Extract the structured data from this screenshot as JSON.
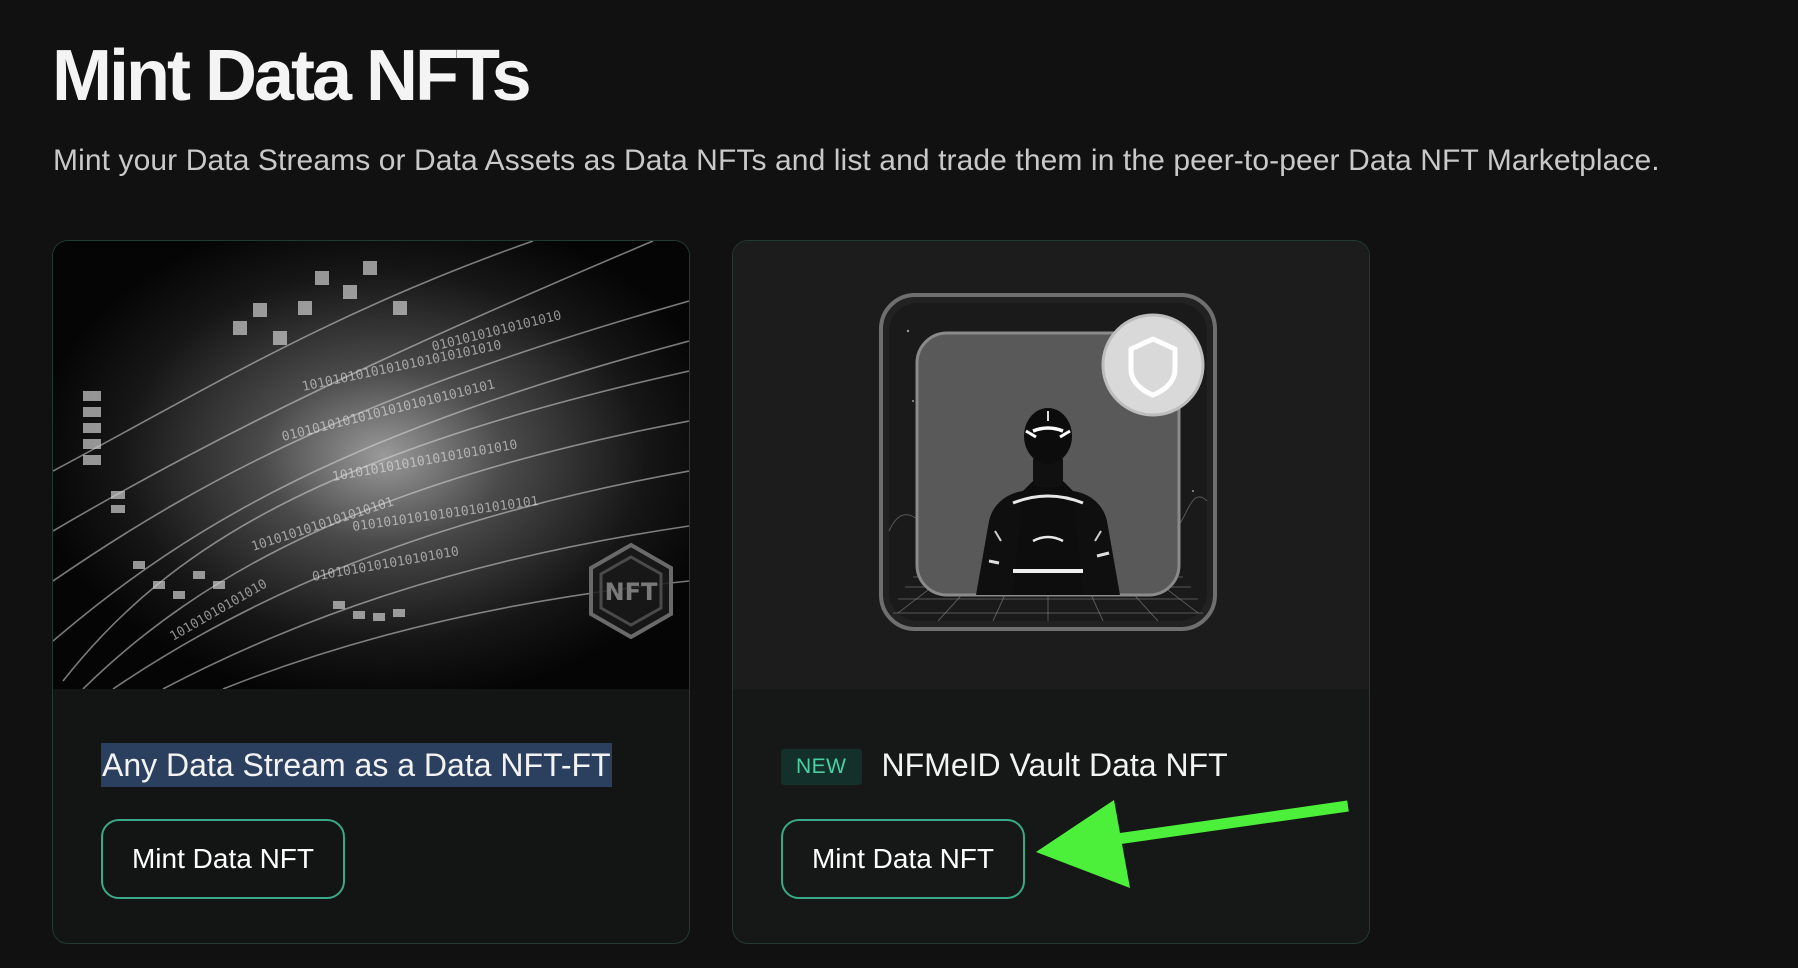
{
  "page": {
    "title": "Mint Data NFTs",
    "subtitle": "Mint your Data Streams or Data Assets as Data NFTs and list and trade them in the peer-to-peer Data NFT Marketplace."
  },
  "cards": [
    {
      "image": "data-stream-nft-artwork",
      "image_badge": "NFT",
      "title": "Any Data Stream as a Data NFT-FT",
      "title_highlighted": true,
      "button_label": "Mint Data NFT"
    },
    {
      "image": "nfmeid-vault-avatar-artwork",
      "image_badge_icon": "shield-icon",
      "badge": "NEW",
      "title": "NFMeID Vault Data NFT",
      "button_label": "Mint Data NFT"
    }
  ],
  "annotation": {
    "icon": "green-arrow-icon",
    "target": "cards.1.button_label"
  },
  "colors": {
    "background": "#111111",
    "card_border": "#233a31",
    "button_border": "#3aa987",
    "badge_text": "#4bd0a0",
    "badge_background": "#13302a",
    "title_highlight": "#2b3f5e",
    "annotation_arrow": "#4cef3a"
  }
}
